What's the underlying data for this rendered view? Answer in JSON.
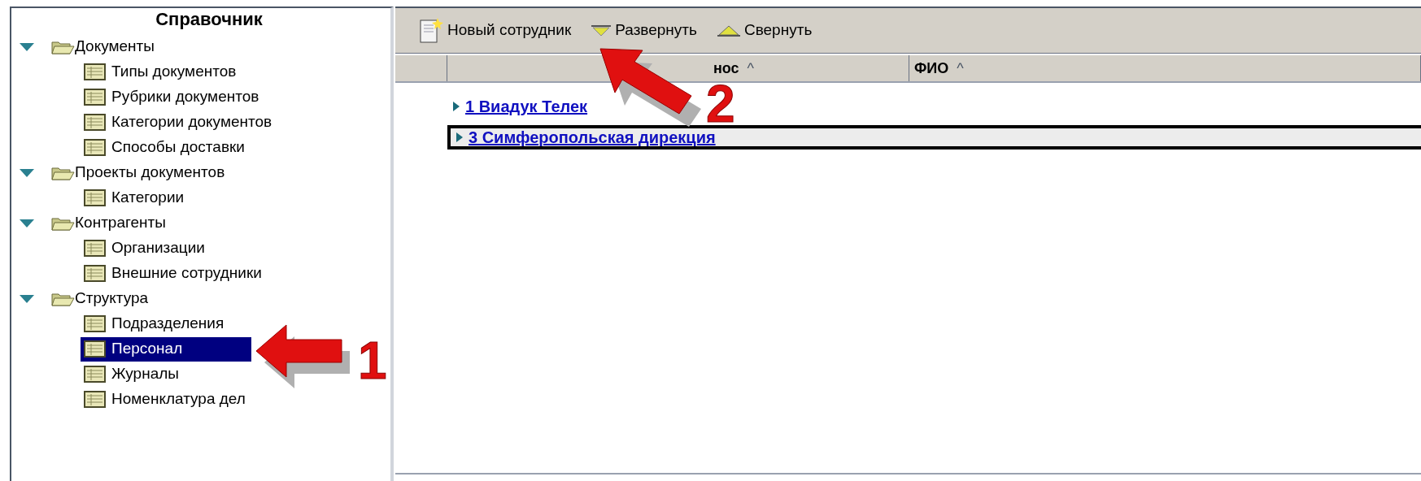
{
  "sidebar": {
    "title": "Справочник",
    "tree": [
      {
        "label": "Документы",
        "kind": "folder",
        "expanded": true,
        "children": [
          {
            "label": "Типы документов",
            "kind": "table",
            "selected": false
          },
          {
            "label": "Рубрики документов",
            "kind": "table",
            "selected": false
          },
          {
            "label": "Категории документов",
            "kind": "table",
            "selected": false
          },
          {
            "label": "Способы доставки",
            "kind": "table",
            "selected": false
          }
        ]
      },
      {
        "label": "Проекты документов",
        "kind": "folder",
        "expanded": true,
        "children": [
          {
            "label": "Категории",
            "kind": "table",
            "selected": false
          }
        ]
      },
      {
        "label": "Контрагенты",
        "kind": "folder",
        "expanded": true,
        "children": [
          {
            "label": "Организации",
            "kind": "table",
            "selected": false
          },
          {
            "label": "Внешние сотрудники",
            "kind": "table",
            "selected": false
          }
        ]
      },
      {
        "label": "Структура",
        "kind": "folder",
        "expanded": true,
        "children": [
          {
            "label": "Подразделения",
            "kind": "table",
            "selected": false
          },
          {
            "label": "Персонал",
            "kind": "table",
            "selected": true
          },
          {
            "label": "Журналы",
            "kind": "table",
            "selected": false
          },
          {
            "label": "Номенклатура дел",
            "kind": "table",
            "selected": false
          }
        ]
      }
    ]
  },
  "toolbar": [
    {
      "label": "Новый сотрудник",
      "kind": "new"
    },
    {
      "label": "Развернуть",
      "kind": "expand"
    },
    {
      "label": "Свернуть",
      "kind": "collapse"
    }
  ],
  "table": {
    "columns": [
      {
        "label": "нос",
        "sort": "^"
      },
      {
        "label": "ФИО",
        "sort": "^"
      }
    ],
    "groups": [
      {
        "label": "1 Виадук Телек",
        "selected": false
      },
      {
        "label": "3 Симферопольская дирекция",
        "selected": true
      }
    ]
  },
  "callouts": [
    {
      "number": "1"
    },
    {
      "number": "2"
    }
  ]
}
